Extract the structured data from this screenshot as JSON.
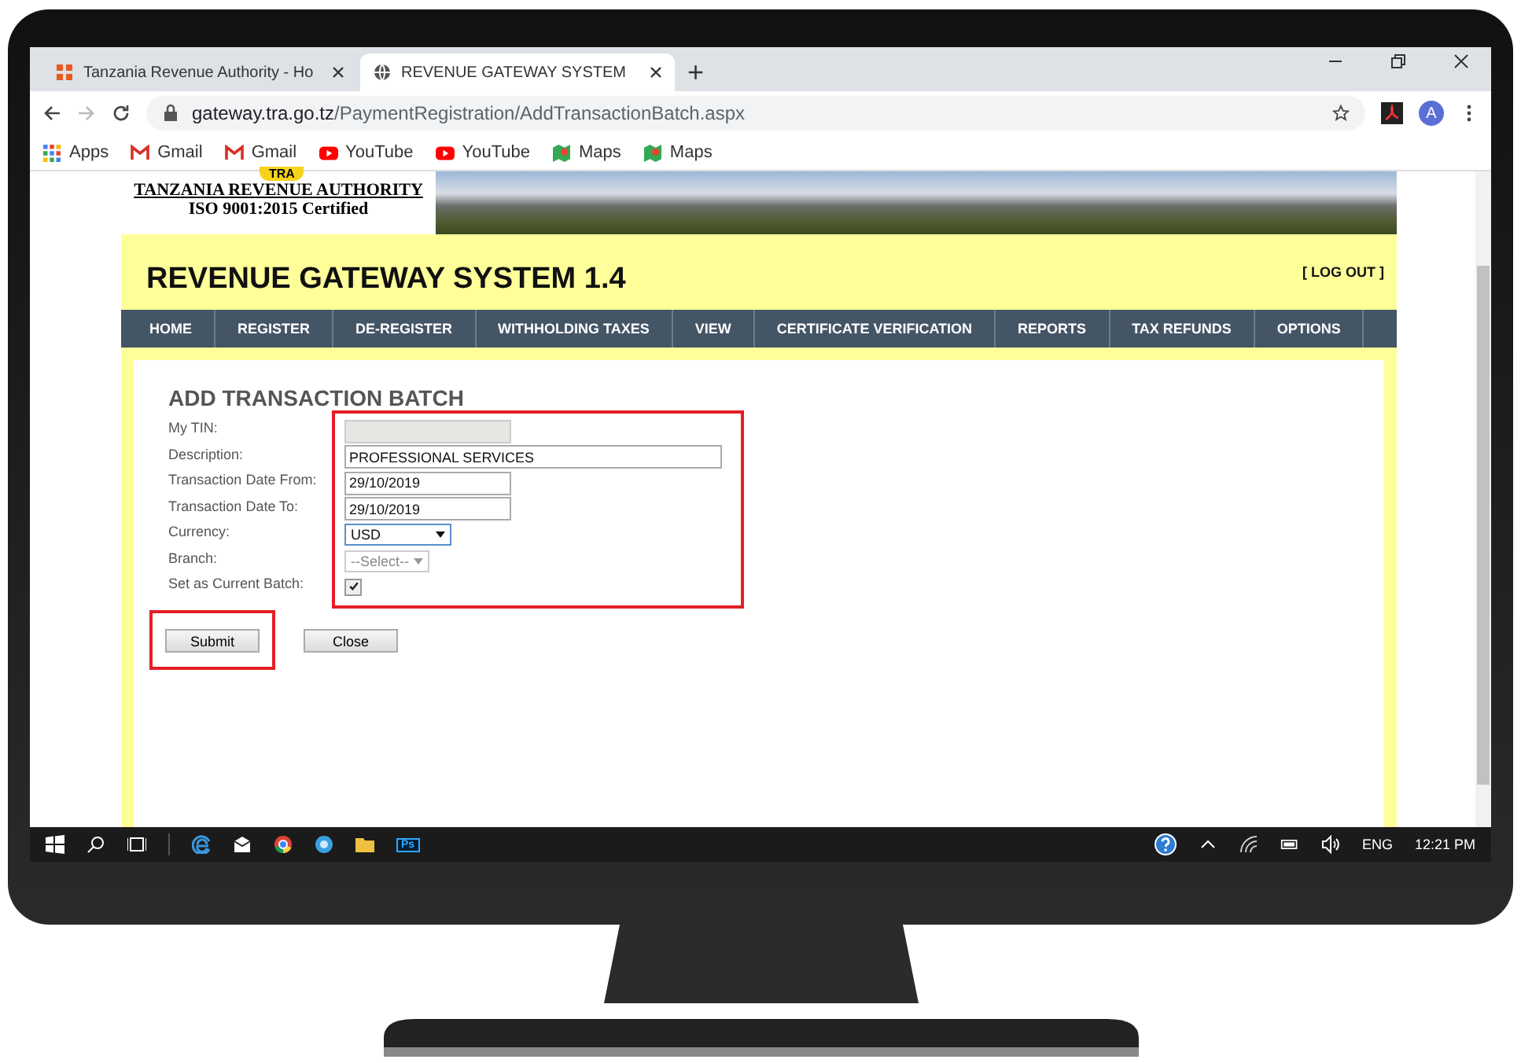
{
  "browser": {
    "tabs": [
      {
        "title": "Tanzania Revenue Authority - Ho",
        "kind": "joomla",
        "selected": false
      },
      {
        "title": "REVENUE GATEWAY SYSTEM",
        "kind": "globe",
        "selected": true
      }
    ],
    "new_tab": "+",
    "address": {
      "host": "gateway.tra.go.tz",
      "path": "/PaymentRegistration/AddTransactionBatch.aspx"
    },
    "avatar": "A",
    "bookmarks": [
      {
        "label": "Apps",
        "kind": "apps"
      },
      {
        "label": "Gmail",
        "kind": "gmail"
      },
      {
        "label": "Gmail",
        "kind": "gmail"
      },
      {
        "label": "YouTube",
        "kind": "youtube"
      },
      {
        "label": "YouTube",
        "kind": "youtube"
      },
      {
        "label": "Maps",
        "kind": "maps"
      },
      {
        "label": "Maps",
        "kind": "maps"
      }
    ]
  },
  "site": {
    "logo": {
      "badge": "TRA",
      "name": "TANZANIA REVENUE AUTHORITY",
      "certification": "ISO 9001:2015 Certified"
    },
    "title": "REVENUE GATEWAY SYSTEM 1.4",
    "logout": "[ LOG OUT ]",
    "nav": [
      "HOME",
      "REGISTER",
      "DE-REGISTER",
      "WITHHOLDING TAXES",
      "VIEW",
      "CERTIFICATE VERIFICATION",
      "REPORTS",
      "TAX REFUNDS",
      "OPTIONS"
    ]
  },
  "form": {
    "heading": "ADD TRANSACTION BATCH",
    "fields": [
      {
        "label": "My TIN:",
        "kind": "text",
        "disabled": true
      },
      {
        "label": "Description:",
        "kind": "wide",
        "value": "PROFESSIONAL SERVICES",
        "disabled": false
      },
      {
        "label": "Transaction Date From:",
        "kind": "text",
        "value": "29/10/2019",
        "disabled": false
      },
      {
        "label": "Transaction Date To:",
        "kind": "text",
        "value": "29/10/2019",
        "disabled": false
      },
      {
        "label": "Currency:",
        "kind": "select",
        "value": "USD",
        "disabled": false
      },
      {
        "label": "Branch:",
        "kind": "select",
        "value": "--Select--",
        "disabled": true
      },
      {
        "label": "Set as Current Batch:",
        "kind": "checkbox",
        "checked": true,
        "disabled": false
      }
    ],
    "fields_highlighted": true,
    "buttons": [
      {
        "label": "Submit",
        "highlighted": true
      },
      {
        "label": "Close",
        "highlighted": false
      }
    ]
  },
  "taskbar": {
    "apps": [
      {
        "kind": "edge"
      },
      {
        "kind": "mail"
      },
      {
        "kind": "chrome"
      },
      {
        "kind": "bubble"
      },
      {
        "kind": "folder"
      },
      {
        "kind": "ps",
        "label": "Ps"
      }
    ],
    "language": "ENG",
    "time": "12:21 PM"
  }
}
